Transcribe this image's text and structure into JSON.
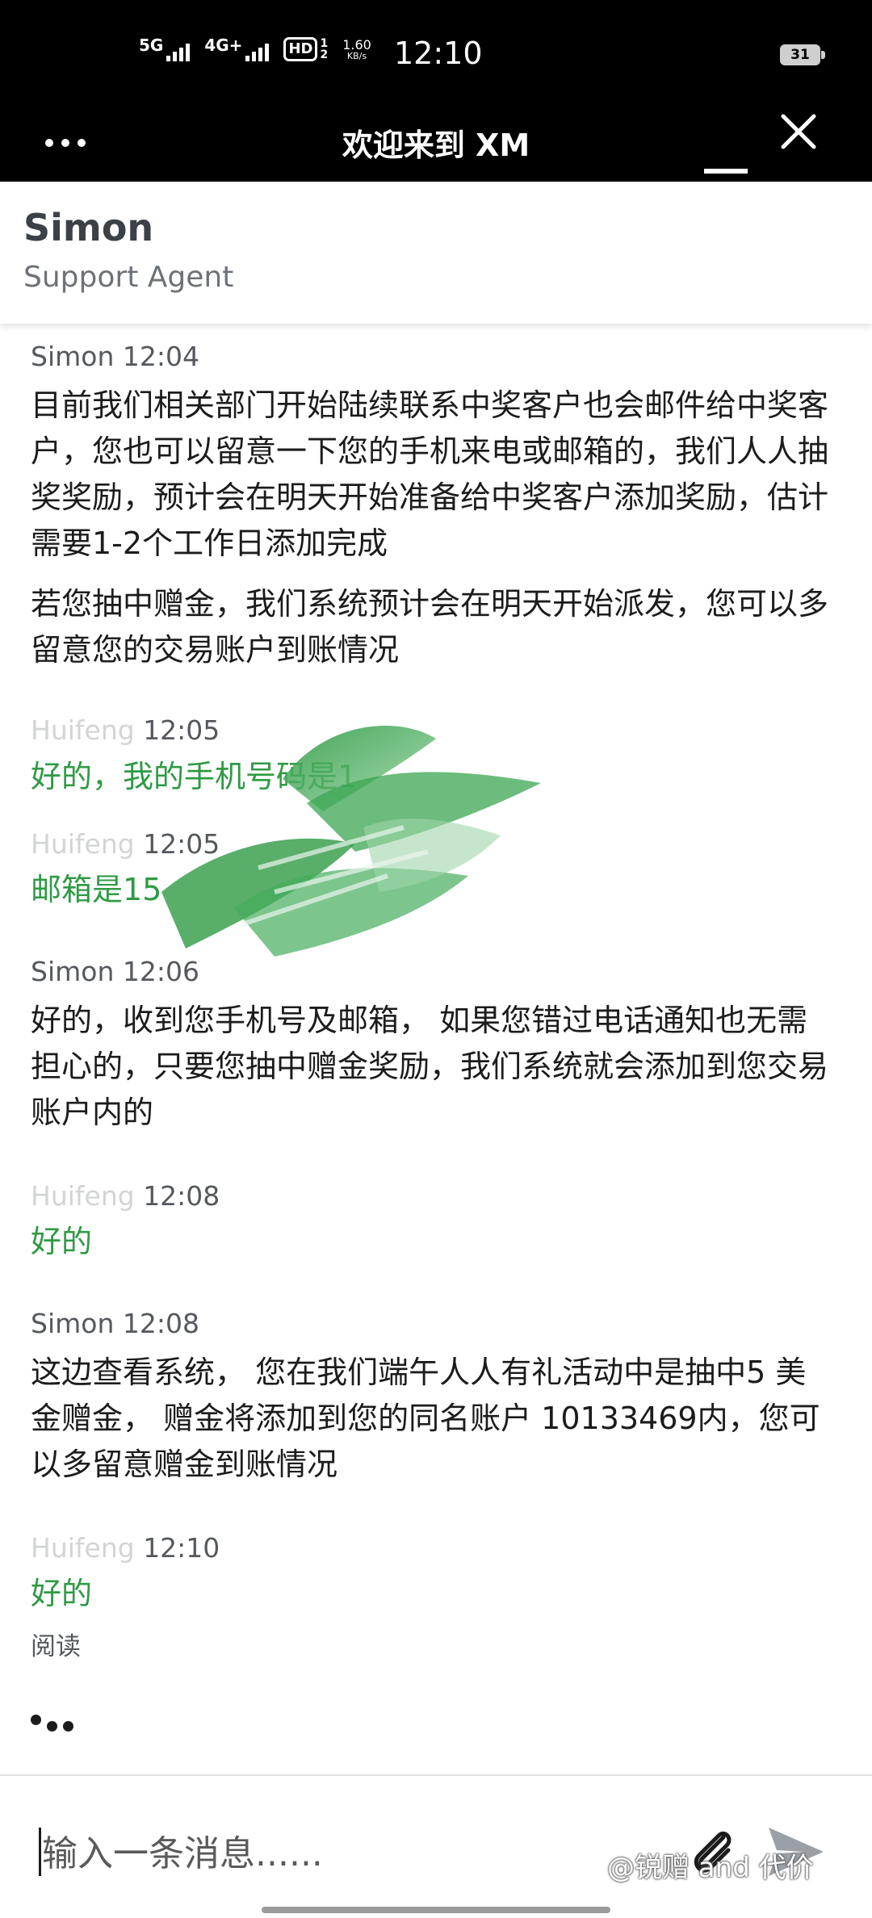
{
  "status_bar": {
    "sim1_label": "5G",
    "sim2_label": "4G+",
    "hd_label": "HD",
    "hd_sub_top": "1",
    "hd_sub_bottom": "2",
    "speed_value": "1.60",
    "speed_unit": "KB/s",
    "time": "12:10",
    "battery": "31"
  },
  "topbar": {
    "title": "欢迎来到 XM",
    "more_icon": "more-dots-icon",
    "minimize_icon": "minimize-icon",
    "close_icon": "close-icon"
  },
  "agent": {
    "name": "Simon",
    "role": "Support Agent"
  },
  "messages": [
    {
      "meta": "Simon 12:04",
      "paragraphs": [
        "目前我们相关部门开始陆续联系中奖客户也会邮件给中奖客户，您也可以留意一下您的手机来电或邮箱的，我们人人抽奖奖励，预计会在明天开始准备给中奖客户添加奖励，估计需要1-2个工作日添加完成",
        "若您抽中赠金，我们系统预计会在明天开始派发，您可以多留意您的交易账户到账情况"
      ]
    },
    {
      "meta_name": "Huifeng",
      "meta_time": "12:05",
      "text": "好的，我的手机号码是1"
    },
    {
      "meta_name": "Huifeng",
      "meta_time": "12:05",
      "text": "邮箱是15"
    },
    {
      "meta": "Simon 12:06",
      "text": "好的，收到您手机号及邮箱， 如果您错过电话通知也无需担心的，只要您抽中赠金奖励，我们系统就会添加到您交易账户内的"
    },
    {
      "meta_name": "Huifeng",
      "meta_time": "12:08",
      "text": "好的"
    },
    {
      "meta": "Simon 12:08",
      "text": "这边查看系统， 您在我们端午人人有礼活动中是抽中5 美金赠金， 赠金将添加到您的同名账户 10133469内，您可以多留意赠金到账情况"
    },
    {
      "meta_name": "Huifeng",
      "meta_time": "12:10",
      "text": "好的",
      "read_status": "阅读"
    }
  ],
  "composer": {
    "placeholder": "输入一条消息......",
    "attach_icon": "paperclip-icon",
    "send_icon": "send-icon"
  },
  "watermark": "@锐赠 and 代价",
  "colors": {
    "bar_background": "#000000",
    "customer_text": "#2f9a45",
    "agent_text": "#1c1c1c",
    "meta_text": "#55595e",
    "redaction_scribble": "#2f9a45"
  }
}
